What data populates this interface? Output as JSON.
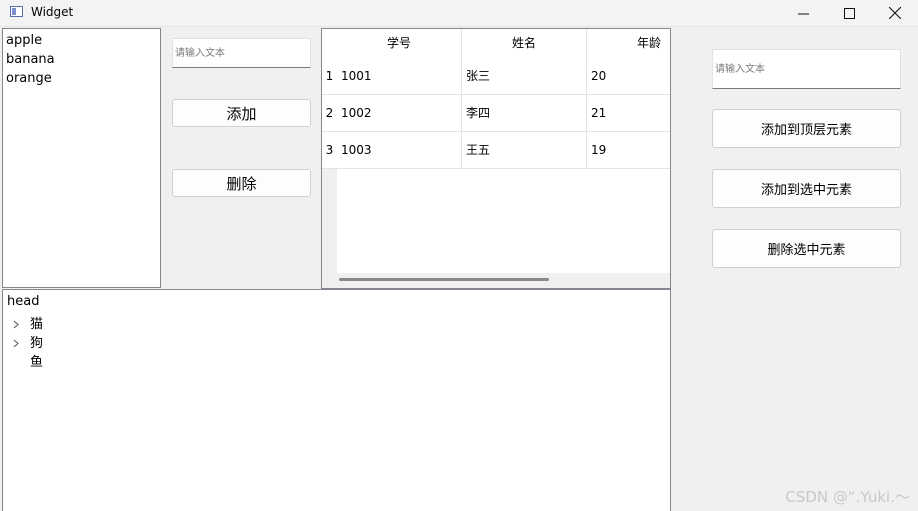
{
  "window": {
    "title": "Widget",
    "controls": [
      "minimize-icon",
      "maximize-icon",
      "close-icon"
    ]
  },
  "list": {
    "items": [
      "apple",
      "banana",
      "orange"
    ]
  },
  "left_controls": {
    "input_placeholder": "请输入文本",
    "add_label": "添加",
    "delete_label": "删除"
  },
  "table": {
    "headers": [
      "学号",
      "姓名",
      "年龄"
    ],
    "row_headers": [
      "1",
      "2",
      "3"
    ],
    "rows": [
      [
        "1001",
        "张三",
        "20"
      ],
      [
        "1002",
        "李四",
        "21"
      ],
      [
        "1003",
        "王五",
        "19"
      ]
    ]
  },
  "tree": {
    "header": "head",
    "items": [
      {
        "label": "猫",
        "expandable": true
      },
      {
        "label": "狗",
        "expandable": true
      },
      {
        "label": "鱼",
        "expandable": false
      }
    ]
  },
  "right_controls": {
    "input_placeholder": "请输入文本",
    "add_top_label": "添加到顶层元素",
    "add_selected_label": "添加到选中元素",
    "delete_selected_label": "删除选中元素"
  },
  "watermark": "CSDN @“.Yuki.～"
}
